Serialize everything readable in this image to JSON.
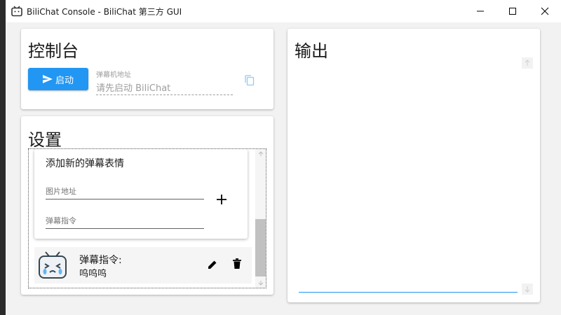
{
  "window": {
    "title": "BiliChat Console - BiliChat 第三方 GUI",
    "minimize_icon": "minimize-icon",
    "maximize_icon": "maximize-icon",
    "close_icon": "close-icon"
  },
  "console": {
    "title": "控制台",
    "start_button": "启动",
    "danmaku_label": "弹幕机地址",
    "danmaku_value": "请先启动 BiliChat",
    "copy_icon": "copy-icon"
  },
  "settings": {
    "title": "设置",
    "add_emote": {
      "title": "添加新的弹幕表情",
      "image_url_label": "图片地址",
      "command_label": "弹幕指令",
      "add_icon": "plus-icon"
    },
    "emotes": [
      {
        "label": "弹幕指令:",
        "command": "呜呜呜",
        "icon": "crying-tv-emote"
      }
    ]
  },
  "output": {
    "title": "输出"
  }
}
